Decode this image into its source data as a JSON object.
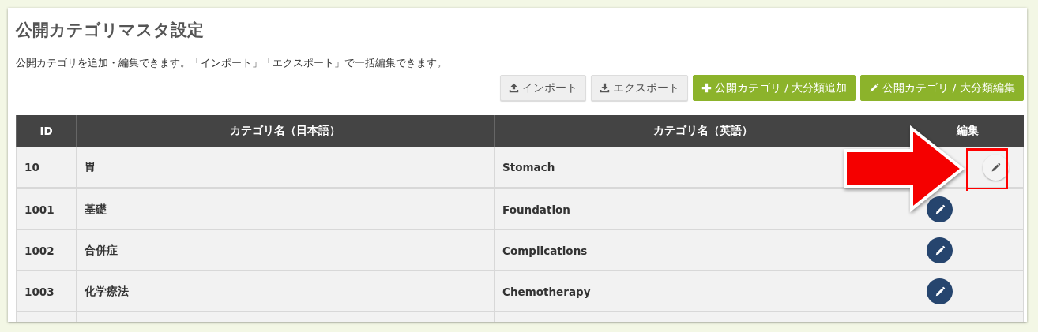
{
  "title": "公開カテゴリマスタ設定",
  "description": "公開カテゴリを追加・編集できます。「インポート」「エクスポート」で一括編集できます。",
  "toolbar": [
    {
      "kind": "import",
      "label": "インポート"
    },
    {
      "kind": "export",
      "label": "エクスポート"
    },
    {
      "kind": "add",
      "label": "公開カテゴリ / 大分類追加"
    },
    {
      "kind": "edit",
      "label": "公開カテゴリ / 大分類編集"
    }
  ],
  "table": {
    "columns": [
      "ID",
      "カテゴリ名（日本語）",
      "カテゴリ名（英語）",
      "編集"
    ],
    "rows": [
      {
        "kind": "major",
        "id": "10",
        "name_ja": "胃",
        "name_en": "Stomach",
        "highlighted": true
      },
      {
        "kind": "minor",
        "id": "1001",
        "name_ja": "基礎",
        "name_en": "Foundation",
        "highlighted": false
      },
      {
        "kind": "minor",
        "id": "1002",
        "name_ja": "合併症",
        "name_en": "Complications",
        "highlighted": false
      },
      {
        "kind": "minor",
        "id": "1003",
        "name_ja": "化学療法",
        "name_en": "Chemotherapy",
        "highlighted": false
      }
    ]
  }
}
